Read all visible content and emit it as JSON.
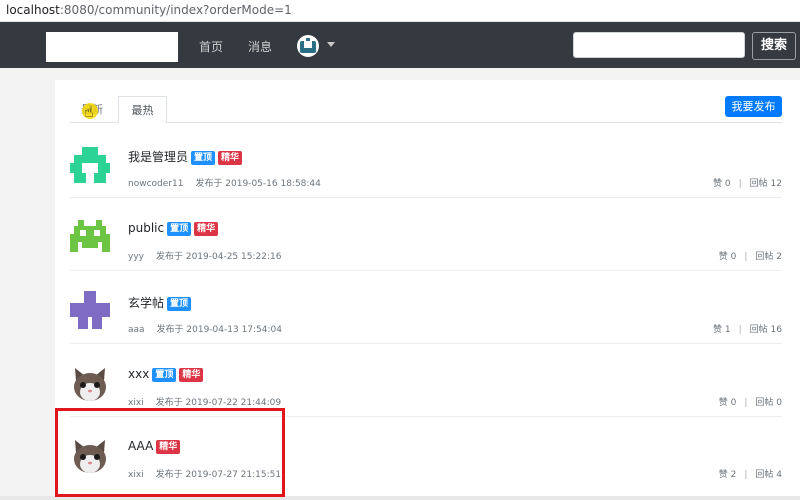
{
  "browser": {
    "url_host": "localhost",
    "url_rest": ":8080/community/index?orderMode=1"
  },
  "navbar": {
    "links": [
      "首页",
      "消息"
    ],
    "search": {
      "value": "",
      "placeholder": ""
    },
    "search_button": "搜索"
  },
  "tabs": [
    {
      "label": "最新",
      "active": false
    },
    {
      "label": "最热",
      "active": true
    }
  ],
  "post_button": "我要发布",
  "posts": [
    {
      "title": "我是管理员",
      "badges": [
        "置顶",
        "精华"
      ],
      "author": "nowcoder11",
      "time": "发布于 2019-05-16 18:58:44",
      "likes": "赞 0",
      "replies": "回帖 12",
      "avatar_icon": "green-pixel-robot-icon"
    },
    {
      "title": "public",
      "badges": [
        "置顶",
        "精华"
      ],
      "author": "yyy",
      "time": "发布于 2019-04-25 15:22:16",
      "likes": "赞 0",
      "replies": "回帖 2",
      "avatar_icon": "green-pixel-invader-icon"
    },
    {
      "title": "玄学帖",
      "badges": [
        "置顶"
      ],
      "author": "aaa",
      "time": "发布于 2019-04-13 17:54:04",
      "likes": "赞 1",
      "replies": "回帖 16",
      "avatar_icon": "purple-pixel-cross-icon"
    },
    {
      "title": "xxx",
      "badges": [
        "置顶",
        "精华"
      ],
      "author": "xixi",
      "time": "发布于 2019-07-22 21:44:09",
      "likes": "赞 0",
      "replies": "回帖 0",
      "avatar_icon": "cat-avatar-icon"
    },
    {
      "title": "AAA",
      "badges": [
        "精华"
      ],
      "author": "xixi",
      "time": "发布于 2019-07-27 21:15:51",
      "likes": "赞 2",
      "replies": "回帖 4",
      "avatar_icon": "cat-avatar-icon"
    }
  ],
  "colors": {
    "navbar": "#343a40",
    "primary": "#007bff",
    "badge_top": "#1e90ff",
    "badge_fine": "#dc3545",
    "highlight": "#e0161c"
  }
}
